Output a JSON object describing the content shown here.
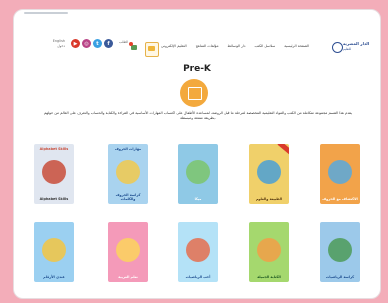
{
  "header": {
    "lang_label": "English",
    "login_label": "دخول",
    "cart_label": "الطلب",
    "nav": [
      "الصفحة الرئيسية",
      "سلاسل الكتب",
      "دار الوسائط",
      "مؤلفات المناهج",
      "التعليم الإلكتروني"
    ],
    "logo_text": "الدار المصرية",
    "logo_sub": "للتعليم",
    "social_icons": [
      "youtube-icon",
      "instagram-icon",
      "twitter-icon",
      "facebook-icon"
    ]
  },
  "main": {
    "title": "Pre-K",
    "description": "يقدم هذا القسم مجموعة متكاملة من الكتب والمواد التعليمية المخصصة لمرحلة ما قبل الروضة، لمساعدة الأطفال على اكتساب المهارات الأساسية في القراءة والكتابة والحساب والتعرف على العالم من حولهم بطريقة ممتعة ومبسطة."
  },
  "books_row1": [
    {
      "top": "Alphabet Skills",
      "title": "Alphabet Skills",
      "color": "#e0e6f0",
      "art": "#c84c3a"
    },
    {
      "top": "مهارات الحروف",
      "title": "كراسة الحروف والكلمات",
      "color": "#a9d3ef",
      "art": "#f2c94c"
    },
    {
      "top": "",
      "title": "ميكا",
      "color": "#8fc9e6",
      "art": "#7cc56b"
    },
    {
      "top": "",
      "title": "الطبيعة والعلوم",
      "color": "#f0d06a",
      "art": "#4aa0d6"
    },
    {
      "top": "",
      "title": "الاكتشاف مع الحروف",
      "color": "#f2a34a",
      "art": "#58a9dd"
    }
  ],
  "books_row2": [
    {
      "top": "",
      "title": "عندي الأرقام",
      "color": "#9bd0f1",
      "art": "#f3c542"
    },
    {
      "top": "",
      "title": "تعلم العربية",
      "color": "#f49ab9",
      "art": "#fbd35c"
    },
    {
      "top": "",
      "title": "أحب الرياضيات",
      "color": "#b4e2f7",
      "art": "#e56f4f"
    },
    {
      "top": "",
      "title": "الكتابة الجميلة",
      "color": "#a5d86e",
      "art": "#f29f48"
    },
    {
      "top": "",
      "title": "كراسة الرياضيات",
      "color": "#9cc9ea",
      "art": "#4d9b58"
    }
  ]
}
